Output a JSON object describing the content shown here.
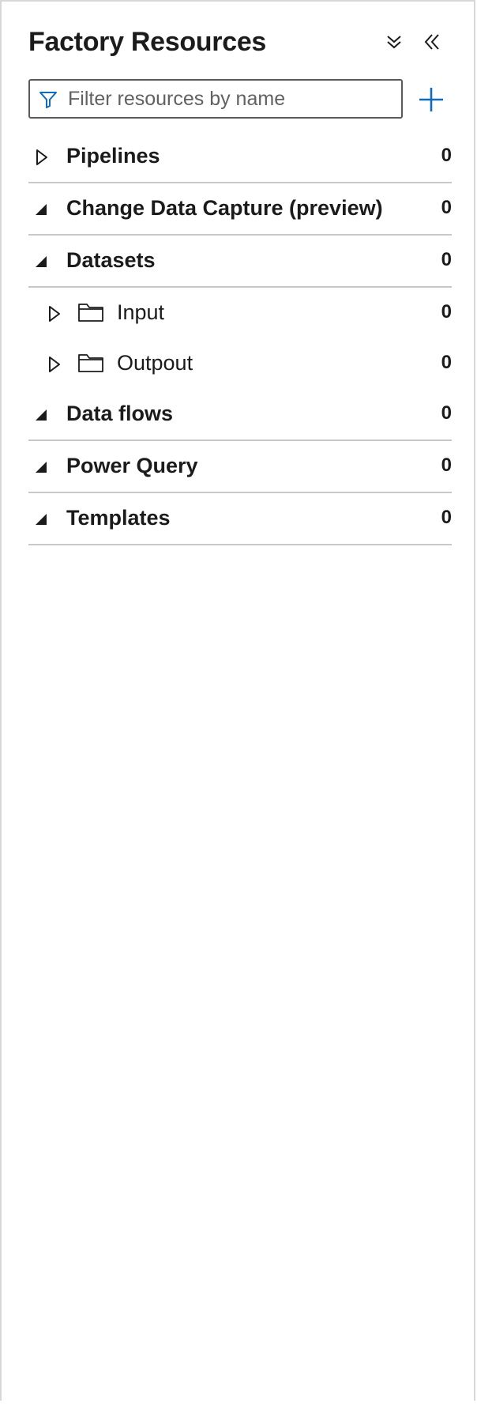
{
  "header": {
    "title": "Factory Resources",
    "expand_all_icon": "double-chevron-down-icon",
    "collapse_panel_icon": "double-chevron-left-icon"
  },
  "filter": {
    "placeholder": "Filter resources by name",
    "value": "",
    "icon": "filter-funnel-icon",
    "add_icon": "plus-icon"
  },
  "tree": {
    "pipelines": {
      "label": "Pipelines",
      "count": "0",
      "state": "collapsed"
    },
    "cdc": {
      "label": "Change Data Capture (preview)",
      "count": "0",
      "state": "expanded"
    },
    "datasets": {
      "label": "Datasets",
      "count": "0",
      "state": "expanded",
      "children": [
        {
          "label": "Input",
          "count": "0",
          "state": "collapsed",
          "icon": "folder-icon"
        },
        {
          "label": "Outpout",
          "count": "0",
          "state": "collapsed",
          "icon": "folder-icon"
        }
      ]
    },
    "dataflows": {
      "label": "Data flows",
      "count": "0",
      "state": "expanded"
    },
    "powerquery": {
      "label": "Power Query",
      "count": "0",
      "state": "expanded"
    },
    "templates": {
      "label": "Templates",
      "count": "0",
      "state": "expanded"
    }
  },
  "colors": {
    "accent": "#0f6cbd",
    "text": "#1b1b1b",
    "divider": "#c8c8c8"
  }
}
